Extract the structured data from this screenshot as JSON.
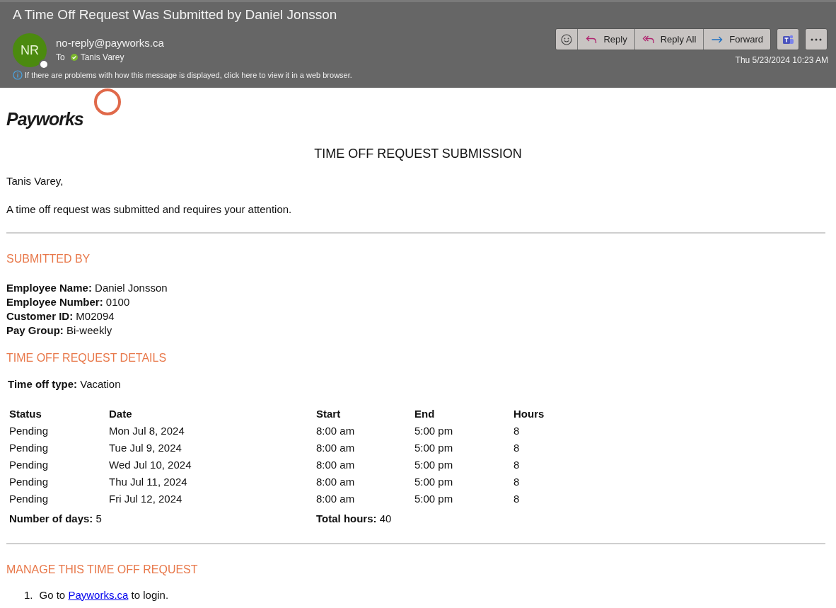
{
  "header": {
    "subject": "A Time Off Request Was Submitted by Daniel Jonsson",
    "avatar_initials": "NR",
    "sender": "no-reply@payworks.ca",
    "to_label": "To",
    "recipient": "Tanis Varey",
    "info_banner": "If there are problems with how this message is displayed, click here to view it in a web browser.",
    "actions": [
      {
        "kind": "emoji"
      },
      {
        "kind": "reply",
        "label": "Reply"
      },
      {
        "kind": "reply_all",
        "label": "Reply All"
      },
      {
        "kind": "forward",
        "label": "Forward"
      }
    ],
    "extra_buttons": [
      {
        "kind": "teams"
      },
      {
        "kind": "more"
      }
    ],
    "date": "Thu 5/23/2024 10:23 AM"
  },
  "body": {
    "logo_text": "Payworks",
    "heading": "TIME OFF REQUEST SUBMISSION",
    "greeting": "Tanis Varey,",
    "intro": "A time off request was submitted and requires your attention.",
    "submitted_by": {
      "title": "SUBMITTED BY",
      "fields": [
        "**Employee Name:** Daniel Jonsson",
        "**Employee Number:** 0100",
        "**Customer ID:** M02094",
        "**Pay Group:** Bi-weekly"
      ]
    },
    "details": {
      "title": "TIME OFF REQUEST DETAILS",
      "type_line": "**Time off type:** Vacation",
      "table": {
        "columns": [
          "Status",
          "Date",
          "Start",
          "End",
          "Hours"
        ],
        "rows": [
          [
            "Pending",
            "Mon Jul 8, 2024",
            "8:00 am",
            "5:00 pm",
            "8"
          ],
          [
            "Pending",
            "Tue Jul 9, 2024",
            "8:00 am",
            "5:00 pm",
            "8"
          ],
          [
            "Pending",
            "Wed Jul 10, 2024",
            "8:00 am",
            "5:00 pm",
            "8"
          ],
          [
            "Pending",
            "Thu Jul 11, 2024",
            "8:00 am",
            "5:00 pm",
            "8"
          ],
          [
            "Pending",
            "Fri Jul 12, 2024",
            "8:00 am",
            "5:00 pm",
            "8"
          ]
        ],
        "totals": [
          "**Number of days:** 5",
          "**Total hours:** 40"
        ]
      }
    },
    "manage": {
      "title": "MANAGE THIS TIME OFF REQUEST",
      "steps": [
        {
          "number": "1.",
          "before": "Go to",
          "link": "Payworks.ca",
          "after": "to login."
        }
      ]
    }
  }
}
